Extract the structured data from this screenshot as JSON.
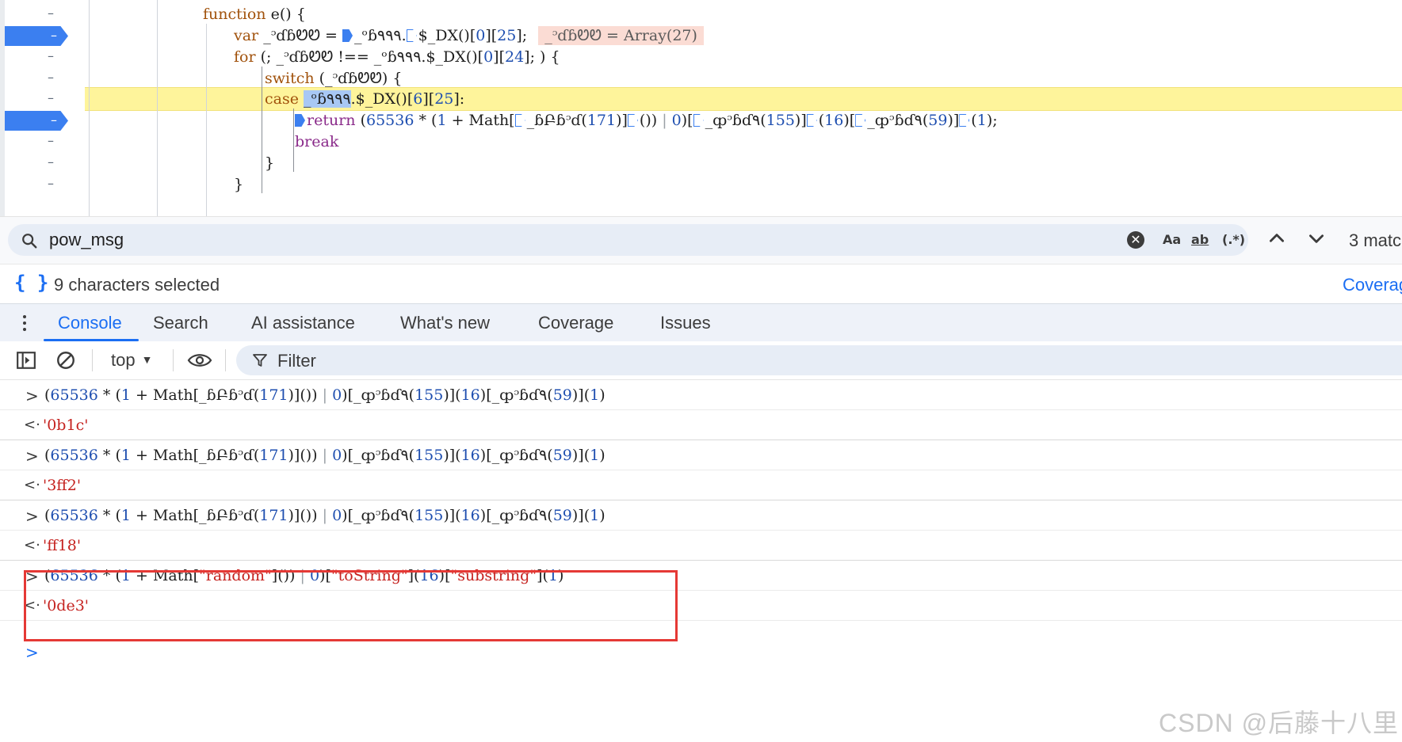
{
  "source": {
    "lines": [
      {
        "line_marker": "–",
        "breakpoint": false
      },
      {
        "line_marker": "–",
        "breakpoint": true
      },
      {
        "line_marker": "–",
        "breakpoint": false
      },
      {
        "line_marker": "–",
        "breakpoint": false
      },
      {
        "line_marker": "–",
        "breakpoint": false
      },
      {
        "line_marker": "–",
        "breakpoint": true
      },
      {
        "line_marker": "–",
        "breakpoint": false
      },
      {
        "line_marker": "–",
        "breakpoint": false
      },
      {
        "line_marker": "–",
        "breakpoint": false
      }
    ],
    "code": {
      "l1_kw": "function",
      "l1_rest": " e() {",
      "l2_kw": "var",
      "l2_a": " _ᵓɗɓᏬᏬ = ",
      "l2_b": "_ᵒɓ٩٩٩.",
      "l2_c": "$_DX()[",
      "l2_d": "0",
      "l2_e": "][",
      "l2_f": "25",
      "l2_g": "];",
      "l2_inline": "_ᵓɗɓᏬᏬ = Array(27)",
      "l3_kw": "for",
      "l3_a": " (; _ᵓɗɓᏬᏬ !== _ᵒɓ٩٩٩.$_DX()[",
      "l3_b": "0",
      "l3_c": "][",
      "l3_d": "24",
      "l3_e": "]; ) {",
      "l4_kw": "switch",
      "l4_rest": " (_ᵓɗɓᏬᏬ) {",
      "l5_kw": "case",
      "l5_sel": "_ᵒɓ٩٩٩",
      "l5_a": ".$_DX()[",
      "l5_b": "6",
      "l5_c": "][",
      "l5_d": "25",
      "l5_e": "]:",
      "l6_kw": "return",
      "l6_a": " (",
      "l6_b": "65536",
      "l6_c": " * (",
      "l6_d": "1",
      "l6_e": " + Math[",
      "l6_f": "_ɓԲɓᵓɗ(",
      "l6_g": "171",
      "l6_h": ")]",
      "l6_i": "()) ",
      "l6_j": "|",
      "l6_k": " ",
      "l6_l": "0",
      "l6_m": ")[",
      "l6_n": "_ȹᵓɓɗ٩(",
      "l6_o": "155",
      "l6_p": ")]",
      "l6_q": "(",
      "l6_r": "16",
      "l6_s": ")[",
      "l6_t": "_ȹᵓɓɗ٩(",
      "l6_u": "59",
      "l6_v": ")]",
      "l6_w": "(",
      "l6_x": "1",
      "l6_y": ");",
      "l7_kw": "break",
      "l8": "}",
      "l9": "}"
    }
  },
  "search": {
    "value": "pow_msg",
    "placeholder": "",
    "clear_glyph": "✕",
    "opt_case": "Aa",
    "opt_word": "ab",
    "opt_regex": "(.*)",
    "match_count": "3 matc"
  },
  "status": {
    "braces": "{ }",
    "text": "9 characters selected",
    "coverage": "Coverag"
  },
  "drawer": {
    "tabs": [
      {
        "label": "Console"
      },
      {
        "label": "Search"
      },
      {
        "label": "AI assistance"
      },
      {
        "label": "What's new"
      },
      {
        "label": "Coverage"
      },
      {
        "label": "Issues"
      }
    ]
  },
  "toolbar": {
    "context": "top",
    "filter_placeholder": "Filter"
  },
  "console": {
    "prompt_in": ">",
    "prompt_out": "<·",
    "obf": {
      "a": "(",
      "b": "65536",
      "c": " * (",
      "d": "1",
      "e": " + Math[_ɓԲɓᵓɗ(",
      "f": "171",
      "g": ")]()) ",
      "h": "|",
      "i": " ",
      "j": "0",
      "k": ")[_ȹᵓɓɗ٩(",
      "l": "155",
      "m": ")](",
      "n": "16",
      "o": ")[_ȹᵓɓɗ٩(",
      "p": "59",
      "q": ")](",
      "r": "1",
      "s": ")"
    },
    "results": [
      "'0b1c'",
      "'3ff2'",
      "'ff18'",
      "'0de3'"
    ],
    "clean": {
      "a": "(",
      "b": "65536",
      "c": " * (",
      "d": "1",
      "e": " + Math[",
      "f": "\"random\"",
      "g": "]()) ",
      "h": "|",
      "i": " ",
      "j": "0",
      "k": ")[",
      "l": "\"toString\"",
      "m": "](",
      "n": "16",
      "o": ")[",
      "p": "\"substring\"",
      "q": "](",
      "r": "1",
      "s": ")"
    },
    "new_prompt": ">"
  },
  "watermark": "CSDN @后藤十八里",
  "colors": {
    "accent": "#1b6ef3",
    "breakpoint": "#3b7ff0",
    "execution_line": "#fef49b",
    "string": "#c5221f",
    "number": "#1f4fb0",
    "keyword": "#a1520c",
    "annotation_box": "#e53935"
  }
}
